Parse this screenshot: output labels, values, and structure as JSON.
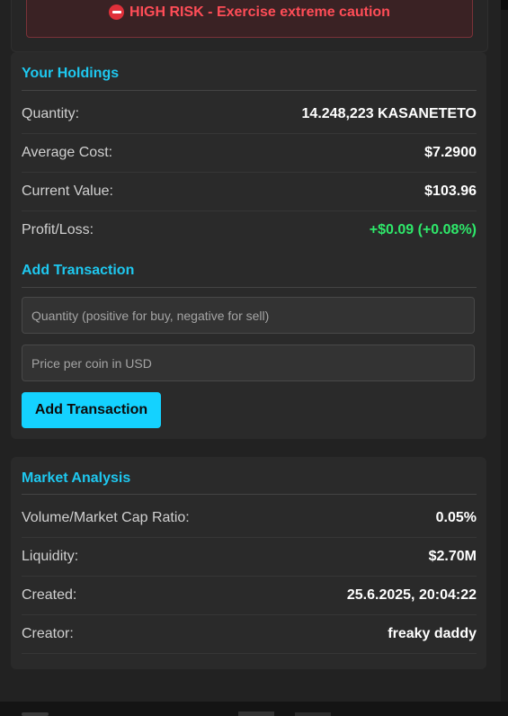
{
  "risk": {
    "label": "HIGH RISK - Exercise extreme caution"
  },
  "holdings": {
    "title": "Your Holdings",
    "rows": [
      {
        "label": "Quantity:",
        "value": "14.248,223 KASANETETO"
      },
      {
        "label": "Average Cost:",
        "value": "$7.2900"
      },
      {
        "label": "Current Value:",
        "value": "$103.96"
      },
      {
        "label": "Profit/Loss:",
        "value": "+$0.09 (+0.08%)"
      }
    ],
    "pnl_color": "#2ee86a"
  },
  "transaction": {
    "title": "Add Transaction",
    "quantity_placeholder": "Quantity (positive for buy, negative for sell)",
    "price_placeholder": "Price per coin in USD",
    "button_label": "Add Transaction"
  },
  "market": {
    "title": "Market Analysis",
    "rows": [
      {
        "label": "Volume/Market Cap Ratio:",
        "value": "0.05%"
      },
      {
        "label": "Liquidity:",
        "value": "$2.70M"
      },
      {
        "label": "Created:",
        "value": "25.6.2025, 20:04:22"
      },
      {
        "label": "Creator:",
        "value": "freaky daddy"
      }
    ]
  },
  "colors": {
    "accent": "#1ec8f0",
    "button": "#14d2ff",
    "danger": "#ff4d57",
    "positive": "#2ee86a"
  },
  "icons": {
    "risk": "no-entry-icon"
  }
}
